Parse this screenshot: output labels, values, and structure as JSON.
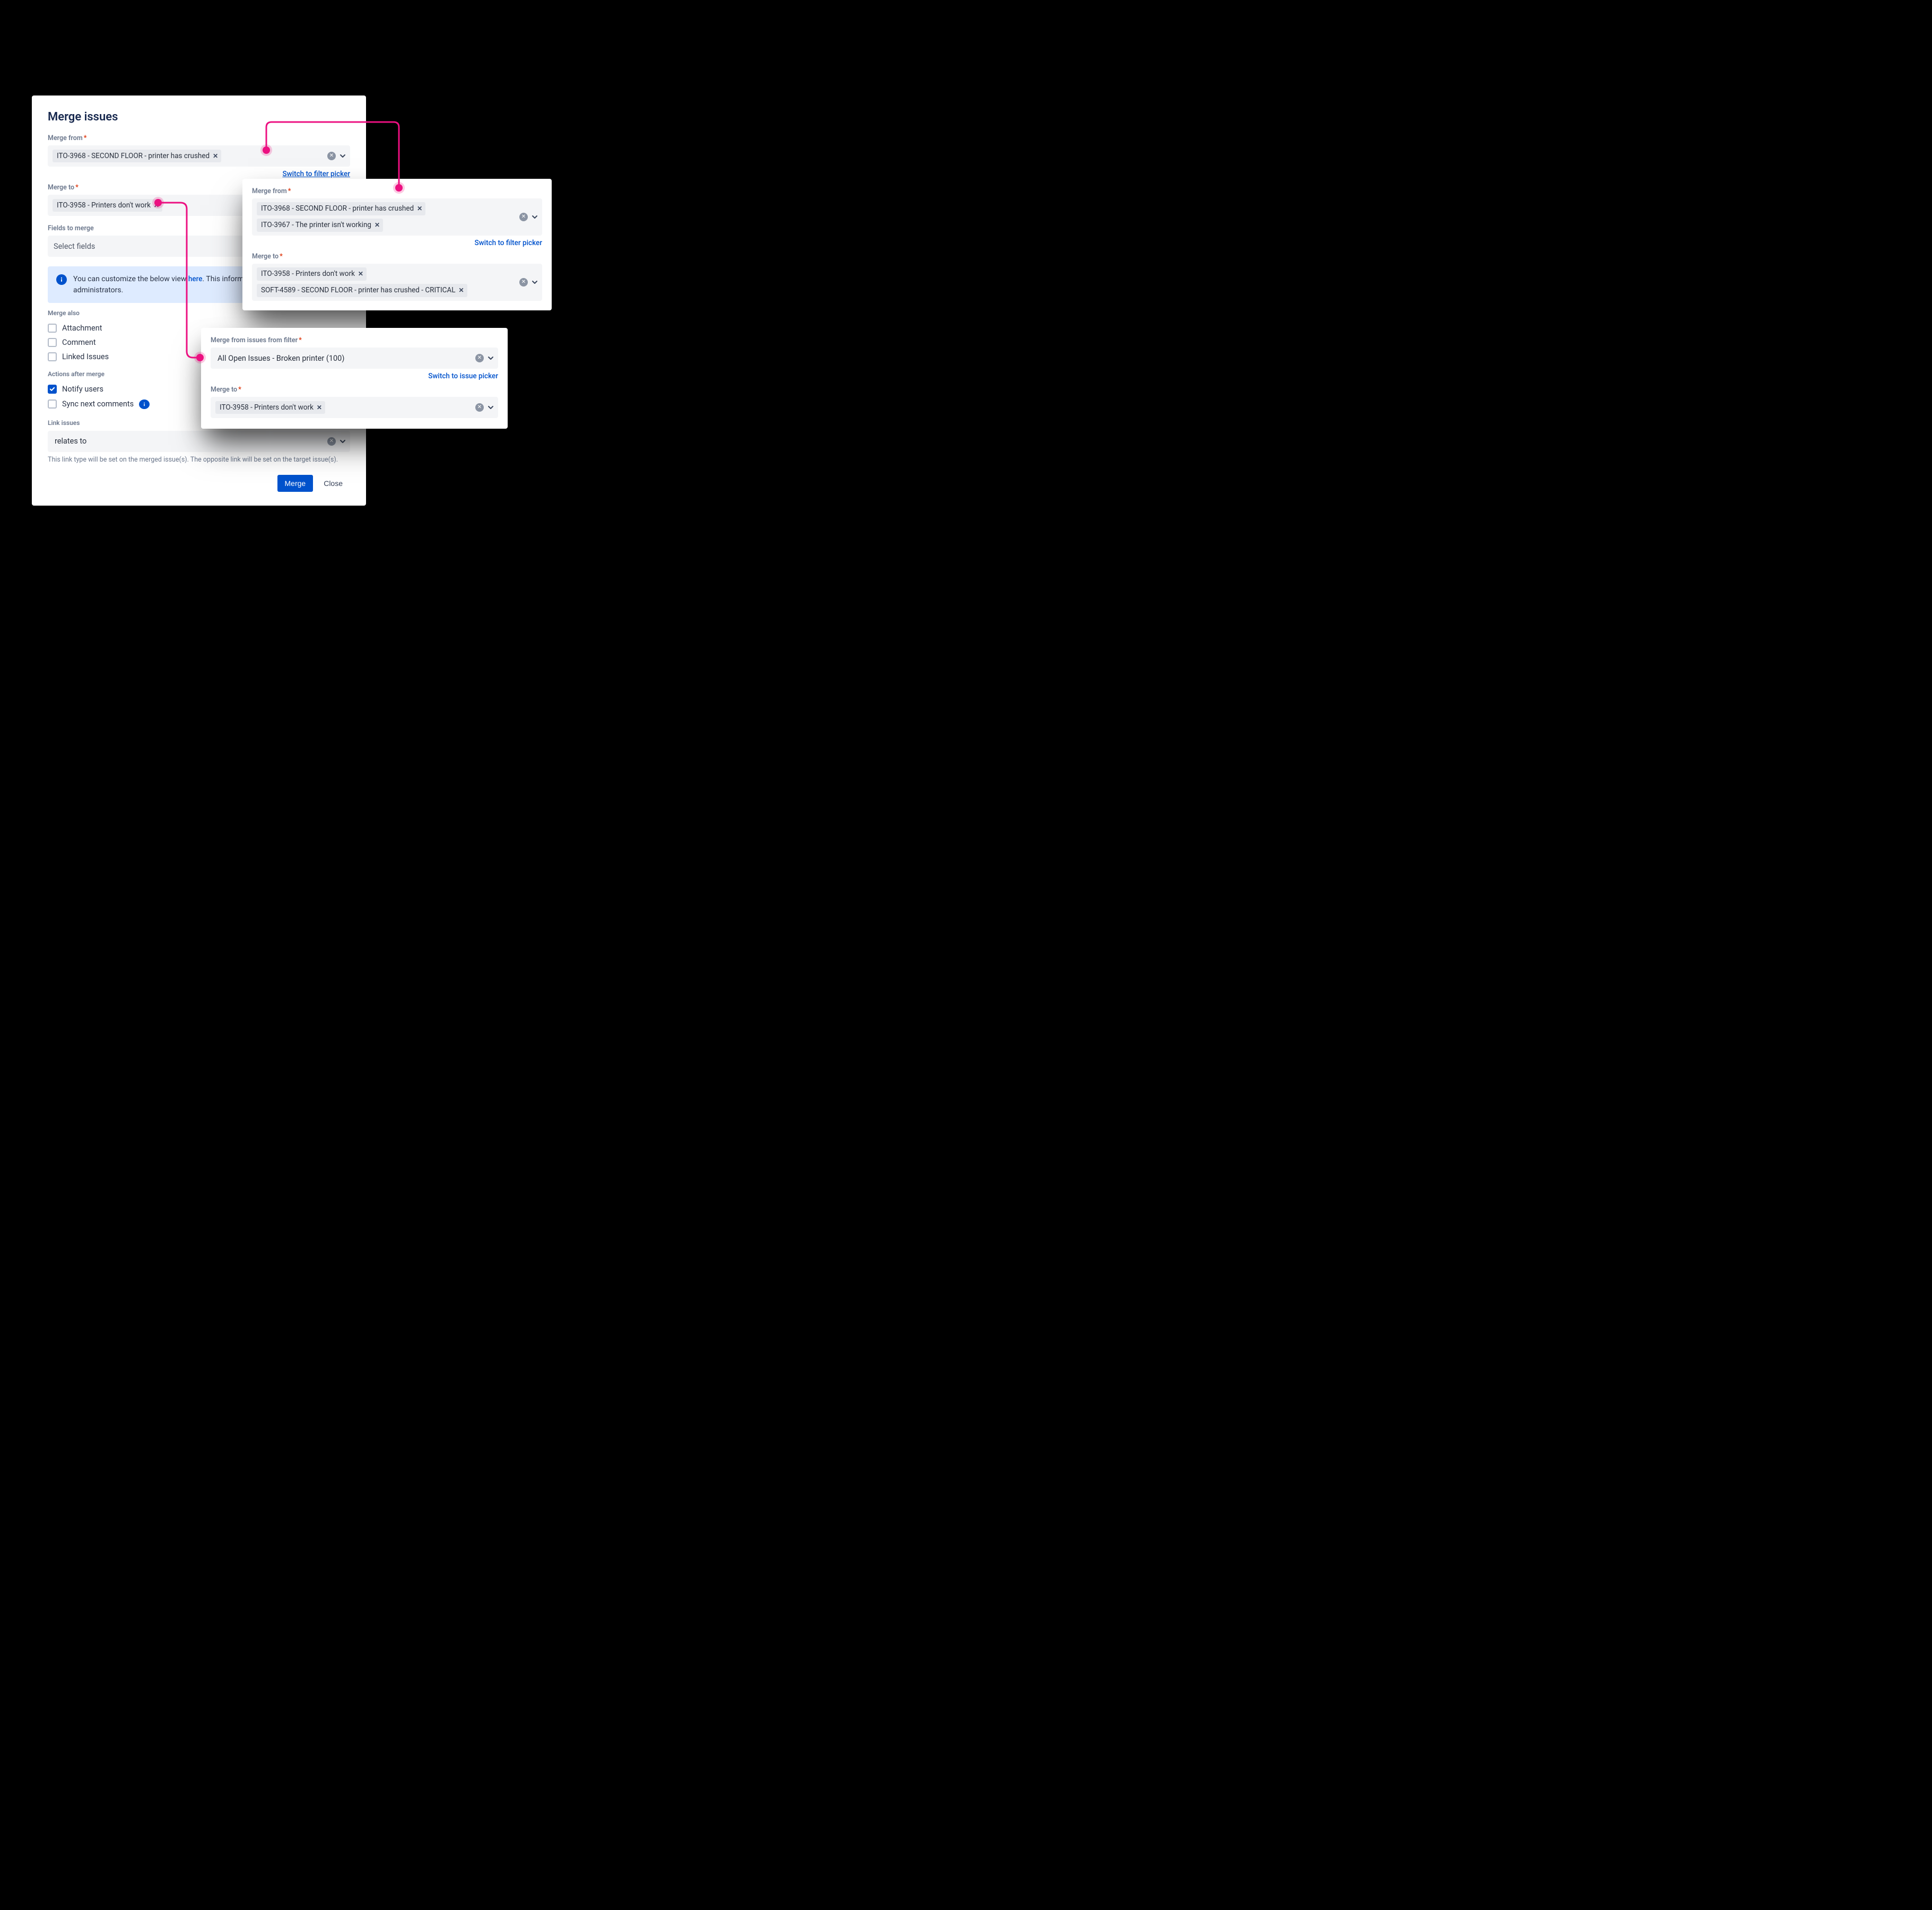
{
  "main": {
    "title": "Merge issues",
    "merge_from": {
      "label": "Merge from",
      "chip": "ITO-3968 - SECOND FLOOR - printer has crushed",
      "switch_link": "Switch to filter picker"
    },
    "merge_to": {
      "label": "Merge to",
      "chip": "ITO-3958 - Printers don't work"
    },
    "fields_to_merge": {
      "label": "Fields to merge",
      "placeholder": "Select fields"
    },
    "info": {
      "text_before": "You can customize the below view ",
      "link": "here",
      "text_after": ". This information is visible only to administrators."
    },
    "merge_also": {
      "label": "Merge also",
      "items": [
        "Attachment",
        "Comment",
        "Linked Issues"
      ]
    },
    "actions_after": {
      "label": "Actions after merge",
      "notify": "Notify users",
      "sync": "Sync next comments"
    },
    "link_issues": {
      "label": "Link issues",
      "value": "relates to",
      "help": "This link type will be set on the merged issue(s). The opposite link will be set on the target issue(s)."
    },
    "buttons": {
      "merge": "Merge",
      "close": "Close"
    }
  },
  "float_top": {
    "merge_from": {
      "label": "Merge from",
      "chips": [
        "ITO-3968 - SECOND FLOOR - printer has crushed",
        "ITO-3967 - The printer isn't working"
      ],
      "switch_link": "Switch to filter picker"
    },
    "merge_to": {
      "label": "Merge to",
      "chips": [
        "ITO-3958 - Printers don't work",
        "SOFT-4589 - SECOND FLOOR - printer has crushed - CRITICAL"
      ]
    }
  },
  "float_bottom": {
    "filter": {
      "label": "Merge from issues from filter",
      "value": "All Open Issues - Broken printer (100)",
      "switch_link": "Switch to issue picker"
    },
    "merge_to": {
      "label": "Merge to",
      "chip": "ITO-3958 - Printers don't work"
    }
  }
}
